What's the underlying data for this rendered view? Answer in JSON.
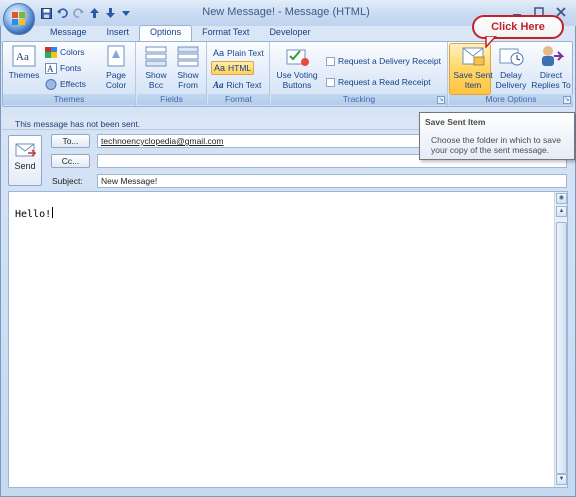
{
  "window": {
    "title": "New Message! - Message (HTML)"
  },
  "quick_access": {
    "icons": [
      "save-icon",
      "undo-icon",
      "redo-icon",
      "up-arrow-icon",
      "down-arrow-icon",
      "customize-icon"
    ]
  },
  "tabs": [
    {
      "label": "Message",
      "active": false
    },
    {
      "label": "Insert",
      "active": false
    },
    {
      "label": "Options",
      "active": true
    },
    {
      "label": "Format Text",
      "active": false
    },
    {
      "label": "Developer",
      "active": false
    }
  ],
  "ribbon": {
    "themes_group": {
      "label": "Themes",
      "themes_button": "Themes",
      "colors": "Colors",
      "fonts": "Fonts",
      "effects": "Effects",
      "page_color": "Page Color"
    },
    "fields_group": {
      "label": "Fields",
      "show_bcc": "Show Bcc",
      "show_from": "Show From"
    },
    "format_group": {
      "label": "Format",
      "plain_text": "Plain Text",
      "html": "HTML",
      "rich_text": "Rich Text",
      "selected": "HTML"
    },
    "tracking_group": {
      "label": "Tracking",
      "voting": "Use Voting Buttons",
      "delivery_receipt": "Request a Delivery Receipt",
      "read_receipt": "Request a Read Receipt"
    },
    "more_options_group": {
      "label": "More Options",
      "save_sent_item": "Save Sent Item",
      "delay_delivery": "Delay Delivery",
      "direct_replies": "Direct Replies To"
    }
  },
  "infobar": {
    "text": "This message has not been sent."
  },
  "compose": {
    "send_label": "Send",
    "to_button": "To...",
    "cc_button": "Cc...",
    "to_value": "technoencyclopedia@gmail.com",
    "cc_value": "",
    "subject_label": "Subject:",
    "subject_value": "New Message!",
    "body_text": "Hello!"
  },
  "tooltip": {
    "title": "Save Sent Item",
    "body": "Choose the folder in which to save your copy of the sent message."
  },
  "callout": {
    "text": "Click Here"
  },
  "colors": {
    "accent_red": "#c2232a",
    "highlight": "#ffd766",
    "ribbon_text": "#15428b"
  }
}
